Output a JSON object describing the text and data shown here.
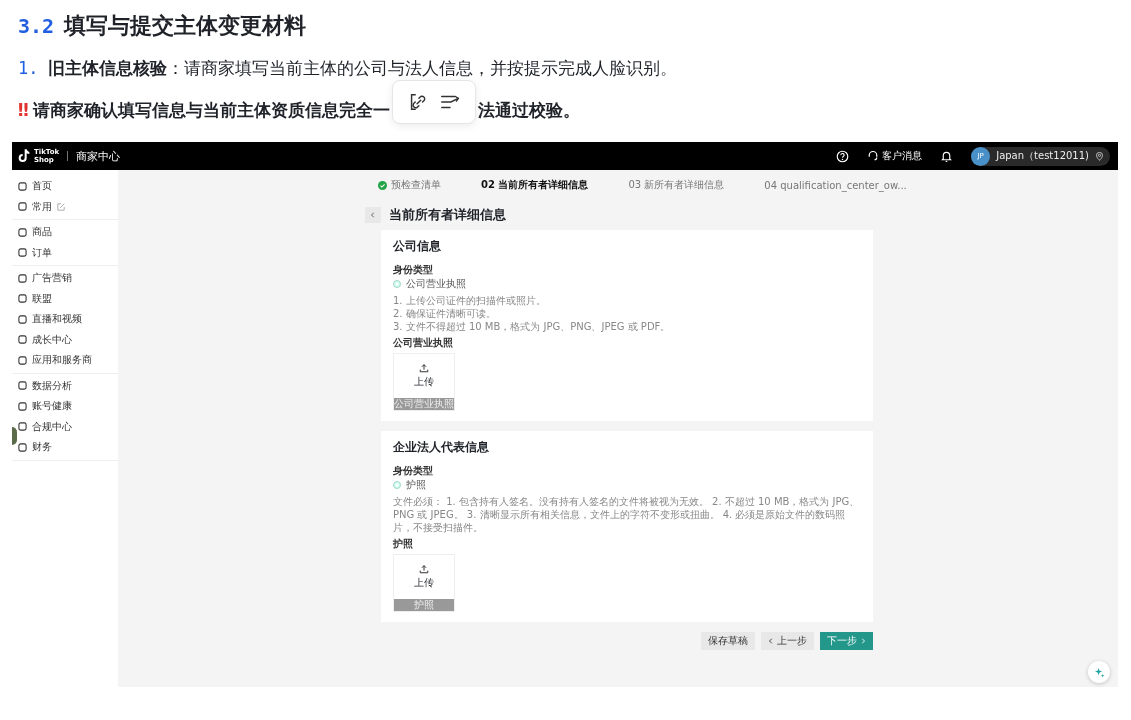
{
  "doc": {
    "section_number": "3.2",
    "heading": "填写与提交主体变更材料",
    "list_item": {
      "number": "1.",
      "text": "**旧主体信息核验**：请商家填写当前主体的公司与法人信息，并按提示完成人脸识别。"
    },
    "warning": {
      "mark": "‼",
      "text_before": "请商家确认填写信息与当前主体资质信息完全一",
      "text_after": "法通过校验。"
    }
  },
  "screenshot": {
    "topbar": {
      "logo_line_1": "TikTok",
      "logo_line_2": "Shop",
      "title": "商家中心",
      "messages_label": "客户消息",
      "account": {
        "avatar": "JP",
        "name": "Japan（test12011)"
      }
    },
    "sidebar": {
      "groups": [
        [
          {
            "label": "首页",
            "editable": false
          },
          {
            "label": "常用",
            "editable": true
          }
        ],
        [
          {
            "label": "商品",
            "editable": false
          },
          {
            "label": "订单",
            "editable": false
          }
        ],
        [
          {
            "label": "广告营销",
            "editable": false
          },
          {
            "label": "联盟",
            "editable": false
          },
          {
            "label": "直播和视频",
            "editable": false
          },
          {
            "label": "成长中心",
            "editable": false
          },
          {
            "label": "应用和服务商",
            "editable": false
          }
        ],
        [
          {
            "label": "数据分析",
            "editable": false
          },
          {
            "label": "账号健康",
            "editable": false
          },
          {
            "label": "合规中心",
            "editable": false
          },
          {
            "label": "财务",
            "editable": false
          }
        ]
      ]
    },
    "steps": [
      {
        "label": "预检查清单",
        "completed": true,
        "selected": false
      },
      {
        "label": "02 当前所有者详细信息",
        "completed": false,
        "selected": true
      },
      {
        "label": "03 新所有者详细信息",
        "completed": false,
        "selected": false
      },
      {
        "label": "04 qualification_center_ow...",
        "completed": false,
        "selected": false
      }
    ],
    "page_title": "当前所有者详细信息",
    "cards": [
      {
        "title": "公司信息",
        "type_label": "身份类型",
        "option": {
          "label": "公司营业执照",
          "selected": true
        },
        "hints": [
          "1. 上传公司证件的扫描件或照片。",
          "2. 确保证件清晰可读。",
          "3. 文件不得超过 10 MB，格式为 JPG、PNG、JPEG 或 PDF。"
        ],
        "upload_label": "公司营业执照",
        "upload_text": "上传",
        "upload_caption": "公司营业执照"
      },
      {
        "title": "企业法人代表信息",
        "type_label": "身份类型",
        "option": {
          "label": "护照",
          "selected": true
        },
        "hints": [
          "文件必须： 1. 包含持有人签名。没有持有人签名的文件将被视为无效。 2. 不超过 10 MB，格式为 JPG、PNG 或 JPEG。 3. 清晰显示所有相关信息，文件上的字符不变形或扭曲。 4. 必须是原始文件的数码照片，不接受扫描件。"
        ],
        "upload_label": "护照",
        "upload_text": "上传",
        "upload_caption": "护照"
      }
    ],
    "buttons": [
      {
        "label": "保存草稿",
        "kind": "plain"
      },
      {
        "label": "上一步",
        "kind": "back"
      },
      {
        "label": "下一步",
        "kind": "primary"
      }
    ]
  }
}
